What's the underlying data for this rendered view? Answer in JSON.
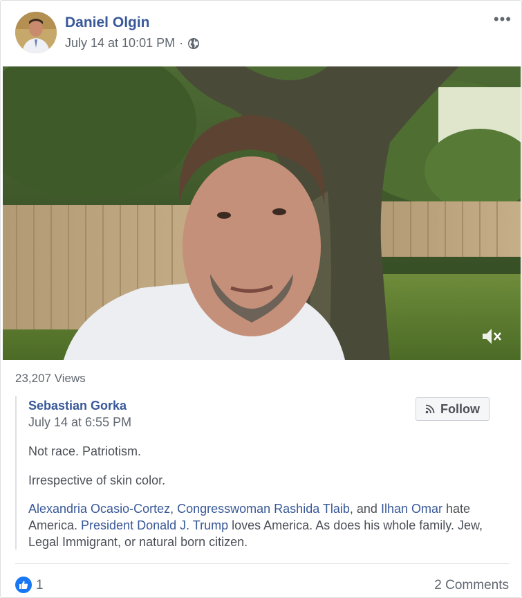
{
  "post": {
    "author": "Daniel Olgin",
    "timestamp": "July 14 at 10:01 PM",
    "separator": "·",
    "privacy_icon": "globe-icon",
    "more_label": "•••",
    "views": "23,207 Views"
  },
  "shared": {
    "author": "Sebastian Gorka",
    "timestamp": "July 14 at 6:55 PM",
    "follow_label": "Follow",
    "paragraph1": "Not race. Patriotism.",
    "paragraph2": "Irrespective of skin color.",
    "p3": {
      "link1": "Alexandria Ocasio-Cortez",
      "sep1": ", ",
      "link2": "Congresswoman Rashida Tlaib",
      "sep2": ", and ",
      "link3": "Ilhan Omar",
      "text1": " hate America. ",
      "link4": "President Donald J. Trump",
      "text2": " loves America. As does his whole family. Jew, Legal Immigrant, or natural born citizen."
    }
  },
  "footer": {
    "like_count": "1",
    "comments": "2 Comments"
  },
  "colors": {
    "link": "#385898",
    "like_blue": "#1877f2"
  }
}
